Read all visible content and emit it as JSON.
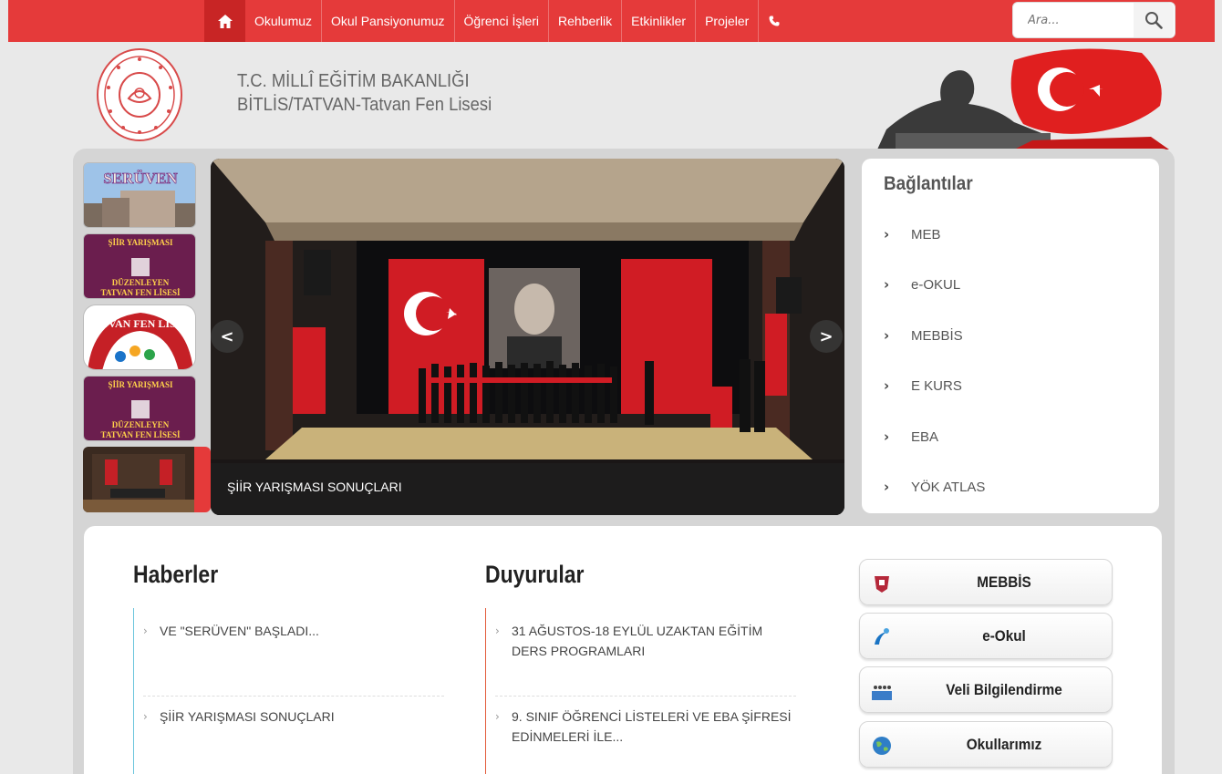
{
  "nav": {
    "items": [
      "Okulumuz",
      "Okul Pansiyonumuz",
      "Öğrenci İşleri",
      "Rehberlik",
      "Etkinlikler",
      "Projeler"
    ],
    "search_placeholder": "Ara..."
  },
  "header": {
    "line1": "T.C. MİLLÎ EĞİTİM BAKANLIĞI",
    "line2": "BİTLİS/TATVAN-Tatvan Fen Lisesi"
  },
  "thumbnails": [
    {
      "label": "SERÜVEN"
    },
    {
      "label": "ŞİİR YARIŞMASI DÜZENLEYEN TATVAN FEN LİSESİ"
    },
    {
      "label": "TATVAN FEN LİSESİ"
    },
    {
      "label": "ŞİİR YARIŞMASI DÜZENLEYEN TATVAN FEN LİSESİ"
    },
    {
      "label": "active slide"
    }
  ],
  "slider": {
    "caption": "ŞİİR YARIŞMASI SONUÇLARI",
    "prev": "<",
    "next": ">"
  },
  "links": {
    "title": "Bağlantılar",
    "items": [
      "MEB",
      "e-OKUL",
      "MEBBİS",
      "E KURS",
      "EBA",
      "YÖK ATLAS"
    ]
  },
  "news": {
    "title": "Haberler",
    "items": [
      "VE \"SERÜVEN\" BAŞLADI...",
      "ŞİİR YARIŞMASI SONUÇLARI"
    ]
  },
  "announcements": {
    "title": "Duyurular",
    "items": [
      "31 AĞUSTOS-18 EYLÜL UZAKTAN EĞİTİM DERS PROGRAMLARI",
      "9. SINIF ÖĞRENCİ LİSTELERİ VE EBA ŞİFRESİ EDİNMELERİ İLE..."
    ]
  },
  "quick_buttons": [
    {
      "label": "MEBBİS",
      "icon": "mebbis-icon"
    },
    {
      "label": "e-Okul",
      "icon": "eokul-icon"
    },
    {
      "label": "Veli Bilgilendirme",
      "icon": "parents-icon"
    },
    {
      "label": "Okullarımız",
      "icon": "globe-icon"
    }
  ],
  "colors": {
    "accent": "#e53a3a",
    "accent_dark": "#c82525",
    "background": "#e9e9e9"
  }
}
